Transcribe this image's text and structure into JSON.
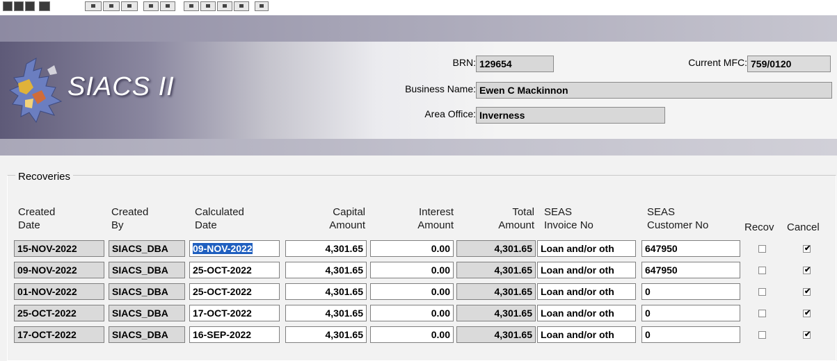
{
  "header": {
    "logo_text": "SIACS II",
    "brn_label": "BRN:",
    "brn_value": "129654",
    "mfc_label": "Current MFC:",
    "mfc_value": "759/0120",
    "business_label": "Business Name:",
    "business_value": "Ewen C Mackinnon",
    "area_label": "Area Office:",
    "area_value": "Inverness"
  },
  "recoveries": {
    "title": "Recoveries",
    "columns": {
      "created_date": [
        "Created",
        "Date"
      ],
      "created_by": [
        "Created",
        "By"
      ],
      "calculated_date": [
        "Calculated",
        "Date"
      ],
      "capital_amount": [
        "Capital",
        "Amount"
      ],
      "interest_amount": [
        "Interest",
        "Amount"
      ],
      "total_amount": [
        "Total",
        "Amount"
      ],
      "seas_invoice": [
        "SEAS",
        "Invoice No"
      ],
      "seas_customer": [
        "SEAS",
        "Customer No"
      ],
      "recov": "Recov",
      "cancel": "Cancel"
    },
    "rows": [
      {
        "created_date": "15-NOV-2022",
        "created_by": "SIACS_DBA",
        "calculated_date": "09-NOV-2022",
        "capital": "4,301.65",
        "interest": "0.00",
        "total": "4,301.65",
        "invoice": "Loan and/or oth",
        "customer": "647950",
        "recov": false,
        "cancel": true
      },
      {
        "created_date": "09-NOV-2022",
        "created_by": "SIACS_DBA",
        "calculated_date": "25-OCT-2022",
        "capital": "4,301.65",
        "interest": "0.00",
        "total": "4,301.65",
        "invoice": "Loan and/or oth",
        "customer": "647950",
        "recov": false,
        "cancel": true
      },
      {
        "created_date": "01-NOV-2022",
        "created_by": "SIACS_DBA",
        "calculated_date": "25-OCT-2022",
        "capital": "4,301.65",
        "interest": "0.00",
        "total": "4,301.65",
        "invoice": "Loan and/or oth",
        "customer": "0",
        "recov": false,
        "cancel": true
      },
      {
        "created_date": "25-OCT-2022",
        "created_by": "SIACS_DBA",
        "calculated_date": "17-OCT-2022",
        "capital": "4,301.65",
        "interest": "0.00",
        "total": "4,301.65",
        "invoice": "Loan and/or oth",
        "customer": "0",
        "recov": false,
        "cancel": true
      },
      {
        "created_date": "17-OCT-2022",
        "created_by": "SIACS_DBA",
        "calculated_date": "16-SEP-2022",
        "capital": "4,301.65",
        "interest": "0.00",
        "total": "4,301.65",
        "invoice": "Loan and/or oth",
        "customer": "0",
        "recov": false,
        "cancel": true
      }
    ]
  },
  "toolbar": {
    "icons": [
      "save-icon",
      "print-icon",
      "open-icon",
      "window-icon",
      "cut-icon",
      "copy-icon",
      "paste-icon",
      "undo-icon",
      "redo-icon",
      "first-record-icon",
      "previous-record-icon",
      "next-record-icon",
      "last-record-icon",
      "help-icon"
    ]
  }
}
